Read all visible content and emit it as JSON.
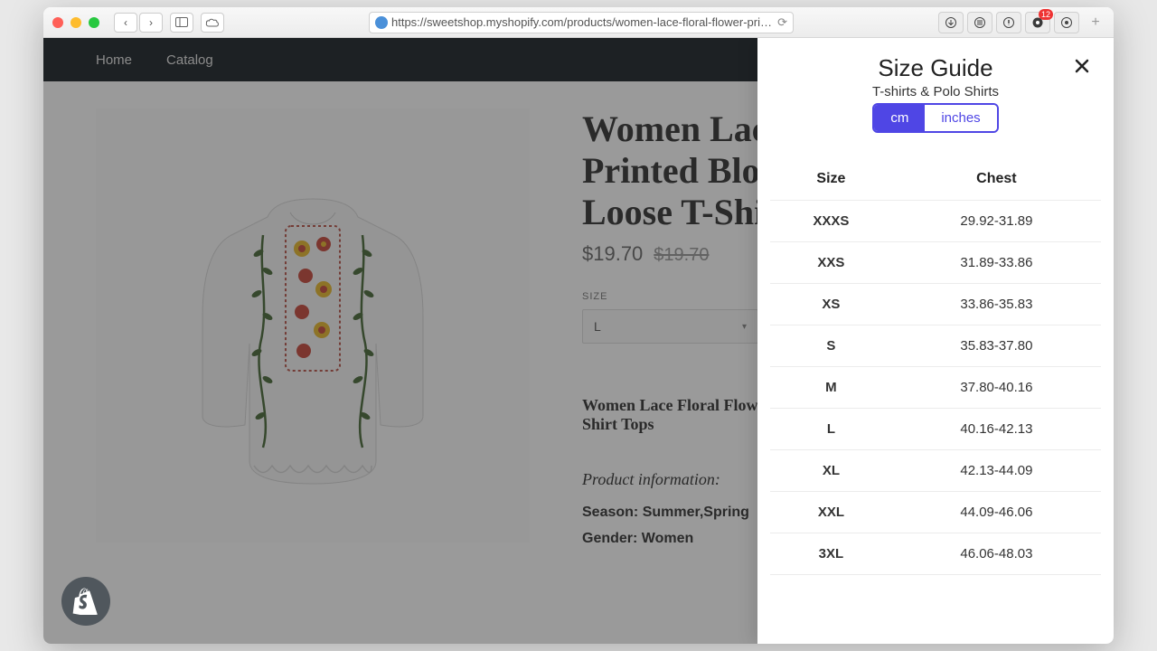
{
  "browser": {
    "url": "https://sweetshop.myshopify.com/products/women-lace-floral-flower-printed-blo",
    "notification_count": "12"
  },
  "store_nav": {
    "home": "Home",
    "catalog": "Catalog"
  },
  "product": {
    "title": "Women Lace Floral Flower Printed Blouse Casual Short Loose T-Shirt Tops",
    "price": "$19.70",
    "compare_price": "$19.70",
    "option_label": "SIZE",
    "option_value": "L",
    "desc_title": "Women Lace Floral Flower Printed Blouse Casual Short Loose T-Shirt Tops",
    "info_heading": "Product information:",
    "info_season": "Season: Summer,Spring",
    "info_gender": "Gender: Women"
  },
  "size_guide": {
    "title": "Size Guide",
    "subtitle": "T-shirts & Polo Shirts",
    "unit_cm": "cm",
    "unit_in": "inches",
    "col_size": "Size",
    "col_chest": "Chest",
    "rows": [
      {
        "size": "XXXS",
        "chest": "29.92-31.89"
      },
      {
        "size": "XXS",
        "chest": "31.89-33.86"
      },
      {
        "size": "XS",
        "chest": "33.86-35.83"
      },
      {
        "size": "S",
        "chest": "35.83-37.80"
      },
      {
        "size": "M",
        "chest": "37.80-40.16"
      },
      {
        "size": "L",
        "chest": "40.16-42.13"
      },
      {
        "size": "XL",
        "chest": "42.13-44.09"
      },
      {
        "size": "XXL",
        "chest": "44.09-46.06"
      },
      {
        "size": "3XL",
        "chest": "46.06-48.03"
      }
    ]
  }
}
